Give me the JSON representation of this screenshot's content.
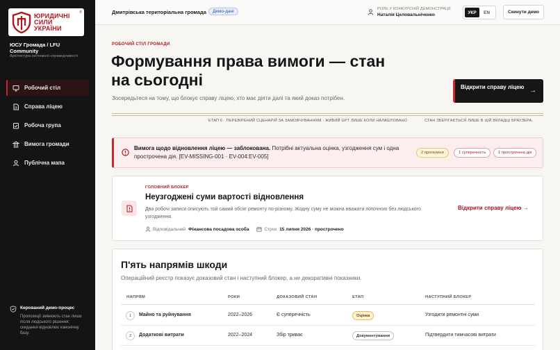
{
  "brand": {
    "logo_text_line1": "ЮРИДИЧНІ",
    "logo_text_line2": "СИЛИ",
    "logo_text_line3": "УКРАЇНИ",
    "org_name": "ЮСУ Громада / LFU Community",
    "org_sub": "Архітектура системної справедливості",
    "accent": "#c8262d"
  },
  "sidebar": {
    "items": [
      {
        "label": "Робочий стіл",
        "icon": "desktop-icon",
        "active": true
      },
      {
        "label": "Справа ліцею",
        "icon": "document-icon",
        "active": false
      },
      {
        "label": "Робоча група",
        "icon": "checklist-icon",
        "active": false
      },
      {
        "label": "Вимога громади",
        "icon": "building-icon",
        "active": false
      },
      {
        "label": "Публічна мапа",
        "icon": "person-icon",
        "active": false
      }
    ],
    "note_title": "Керований демо-процес",
    "note_text": "Пропозиції змінюють стан лише після людського рішення; скидання відновлює канонічну базу."
  },
  "topbar": {
    "community": "Дмитрівська територіальна громада",
    "demo_badge": "Демо-дані",
    "role_label": "РОЛЬ У КОНКУРСНІЙ ДЕМОНСТРАЦІЇ",
    "role_name": "Наталія Целовальніченко",
    "lang_active": "УКР",
    "lang_other": "EN",
    "reset_label": "Скинути демо"
  },
  "hero": {
    "eyebrow": "РОБОЧИЙ СТІЛ ГРОМАДИ",
    "title": "Формування права вимоги — стан на сьогодні",
    "lead": "Зосередьтеся на тому, що блокує справу ліцею, хто має діяти далі та який доказ потрібен.",
    "open_case_label": "Відкрити справу ліцею",
    "stage": "ЕТАП 6 · ПЕРЕВІРЕНИЙ СЦЕНАРІЙ ЗА ЗАМОВЧУВАННЯМ · ЖИВИЙ GPT ЛИШЕ КОЛИ НАЛАШТОВАНО",
    "stage_note": "СТАН ЗБЕРІГАЄТЬСЯ ЛИШЕ В ЦІЙ ВКЛАДЦІ БРАУЗЕРА."
  },
  "alert": {
    "title": "Вимога щодо відновлення ліцею — заблокована.",
    "text": " Потрібні актуальна оцінка, узгодження сум і одна прострочена дія. [EV-MISSING-001 · EV-004:EV-005]",
    "pills": [
      "2 прогалини",
      "1 суперечність",
      "1 прострочена дія"
    ]
  },
  "blocker": {
    "eyebrow": "ГОЛОВНИЙ БЛОКЕР",
    "title": "Неузгоджені суми вартості відновлення",
    "text": "Два робочі записи описують той самий обсяг ремонту по-різному. Жодну суму не можна вважати поточною без людського узгодження.",
    "owner_label": "Відповідальний",
    "owner_value": "Фінансова посадова особа",
    "due_label": "Строк",
    "due_value": "15 липня 2026 · прострочено",
    "link_label": "Відкрити справу ліцею"
  },
  "directions": {
    "title": "П'ять напрямів шкоди",
    "subtitle": "Операційний реєстр показує доказовий стан і наступний блокер, а не декоративні показники.",
    "columns": [
      "НАПРЯМ",
      "РОКИ",
      "ДОКАЗОВИЙ СТАН",
      "ЕТАП",
      "НАСТУПНИЙ БЛОКЕР"
    ],
    "rows": [
      {
        "num": "1",
        "name": "Майно та руйнування",
        "years": "2022–2026",
        "evidence": "Є суперечність",
        "stage": "Оцінка",
        "stage_style": "amber",
        "next": "Узгодити ремонтні суми"
      },
      {
        "num": "2",
        "name": "Додаткові витрати",
        "years": "2022–2024",
        "evidence": "Збір триває",
        "stage": "Документування",
        "stage_style": "grey",
        "next": "Підтвердити тимчасові витрати"
      }
    ]
  }
}
